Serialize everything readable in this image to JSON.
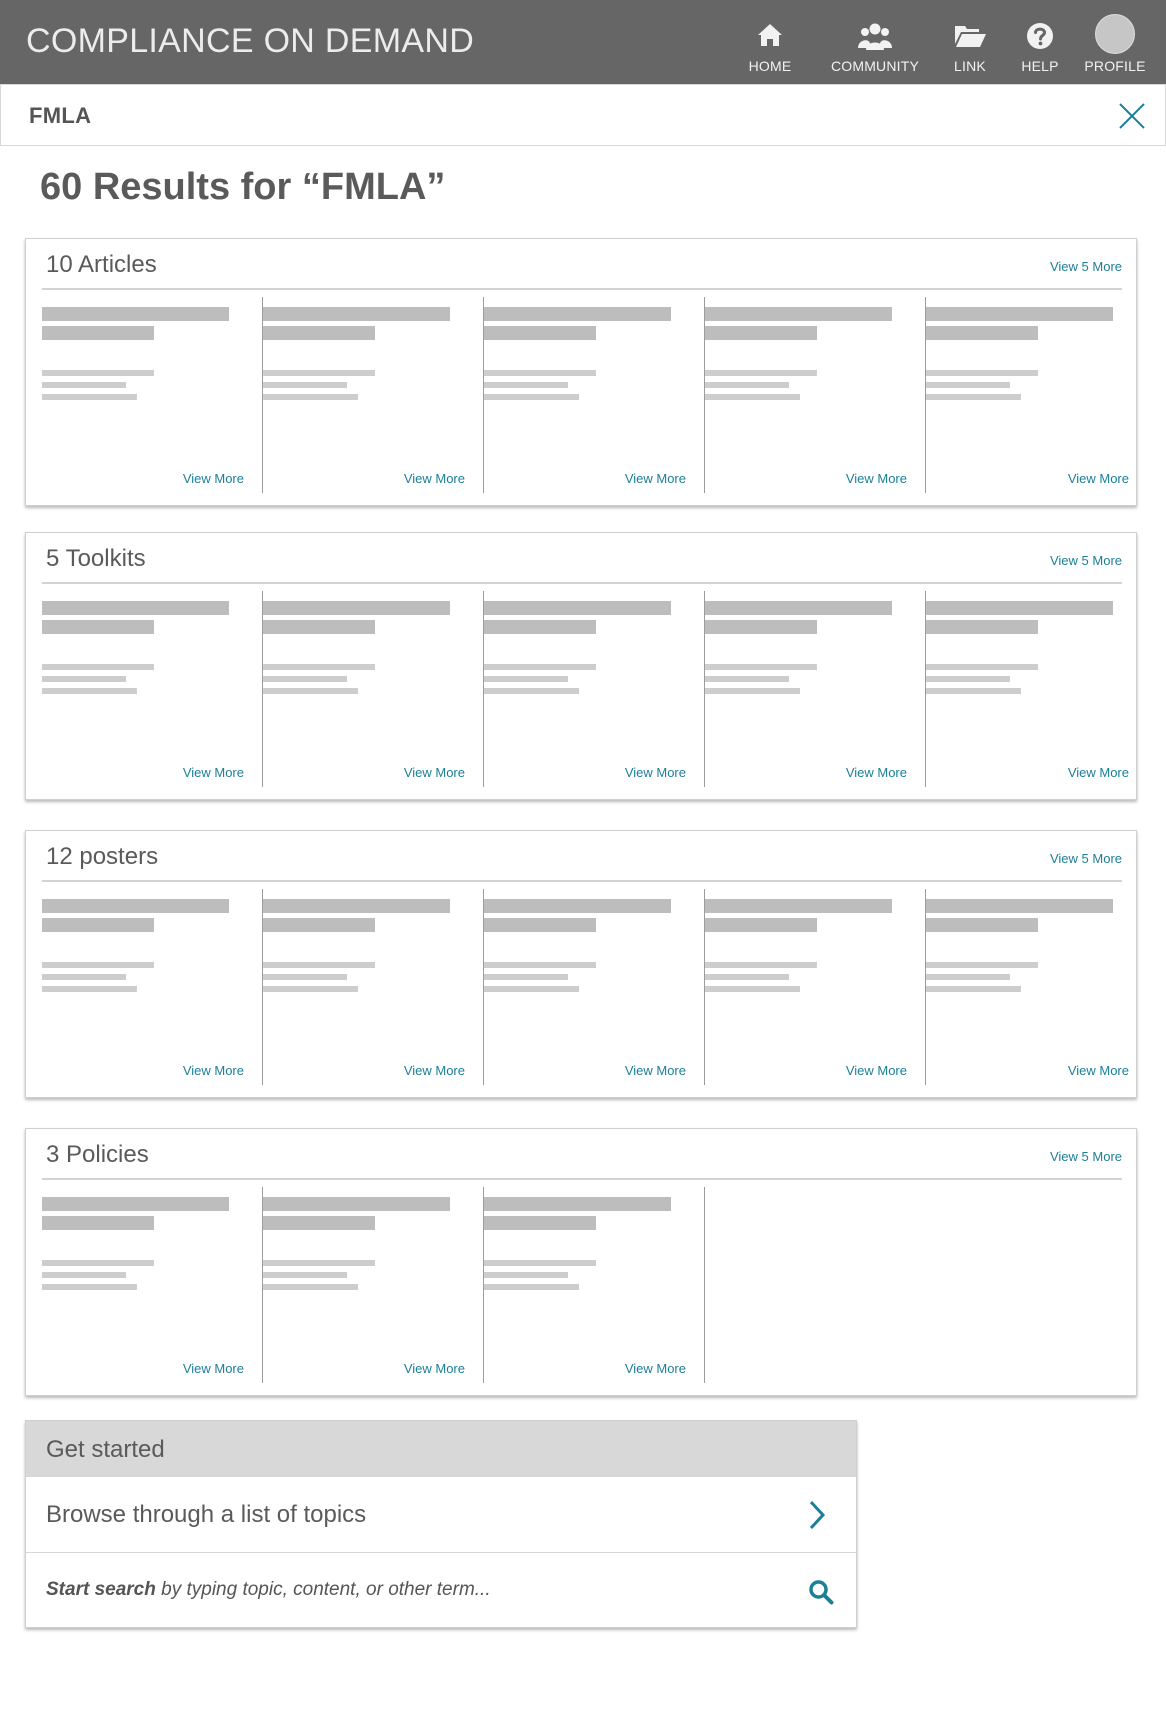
{
  "header": {
    "brand": "COMPLIANCE ON DEMAND",
    "nav": {
      "home": {
        "label": "HOME",
        "icon": "home-icon"
      },
      "community": {
        "label": "COMMUNITY",
        "icon": "users-icon"
      },
      "link": {
        "label": "LINK",
        "icon": "folder-open-icon"
      },
      "help": {
        "label": "HELP",
        "icon": "question-icon"
      },
      "profile": {
        "label": "PROFILE",
        "icon": "avatar"
      }
    }
  },
  "search_term": {
    "value": "FMLA",
    "close_icon": "close-icon"
  },
  "results_title": "60 Results for “FMLA”",
  "sections": [
    {
      "title": "10 Articles",
      "more": "View 5 More",
      "cards": [
        "View More",
        "View More",
        "View More",
        "View More",
        "View More"
      ]
    },
    {
      "title": "5 Toolkits",
      "more": "View 5 More",
      "cards": [
        "View More",
        "View More",
        "View More",
        "View More",
        "View More"
      ]
    },
    {
      "title": "12 posters",
      "more": "View 5 More",
      "cards": [
        "View More",
        "View More",
        "View More",
        "View More",
        "View More"
      ]
    },
    {
      "title": "3 Policies",
      "more": "View 5 More",
      "cards": [
        "View More",
        "View More",
        "View More"
      ]
    }
  ],
  "get_started": {
    "title": "Get started",
    "browse": "Browse through a list of topics",
    "search_bold": "Start search",
    "search_rest": " by typing topic, content, or other term...",
    "accent": "#1b7f98"
  }
}
